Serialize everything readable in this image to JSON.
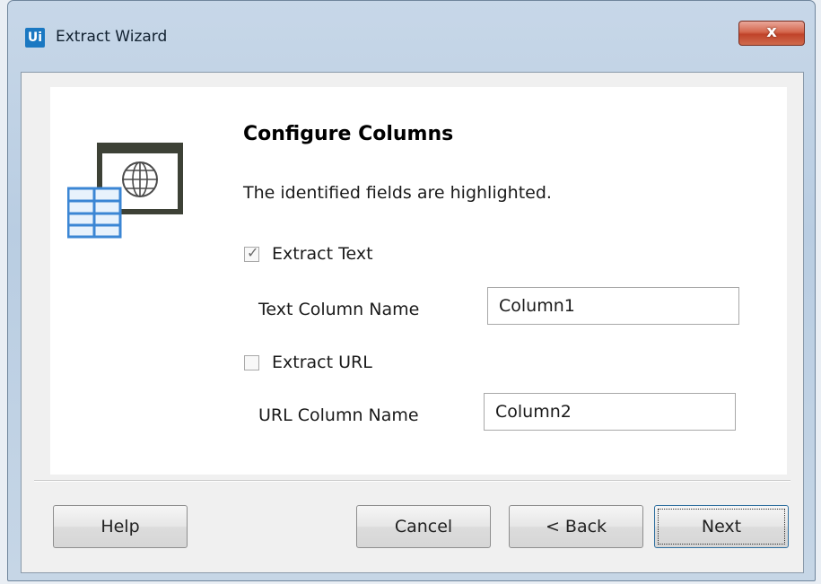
{
  "window": {
    "logo": "Ui",
    "title": "Extract Wizard",
    "close_glyph": "x"
  },
  "wizard": {
    "heading": "Configure Columns",
    "description": "The identified fields are highlighted.",
    "extract_text": {
      "label": "Extract Text",
      "checked": true
    },
    "text_column": {
      "label": "Text Column Name",
      "value": "Column1"
    },
    "extract_url": {
      "label": "Extract URL",
      "checked": false
    },
    "url_column": {
      "label": "URL Column Name",
      "value": "Column2"
    }
  },
  "buttons": {
    "help": "Help",
    "cancel": "Cancel",
    "back": "< Back",
    "next": "Next"
  },
  "colors": {
    "logo_blue": "#1a78c2",
    "close_red": "#c0432a",
    "graphic_dark": "#3d4136",
    "graphic_blue": "#3b86d4"
  },
  "icons": {
    "wizard_graphic": "table-web-page-icon",
    "checkmark": "checkmark-icon"
  }
}
